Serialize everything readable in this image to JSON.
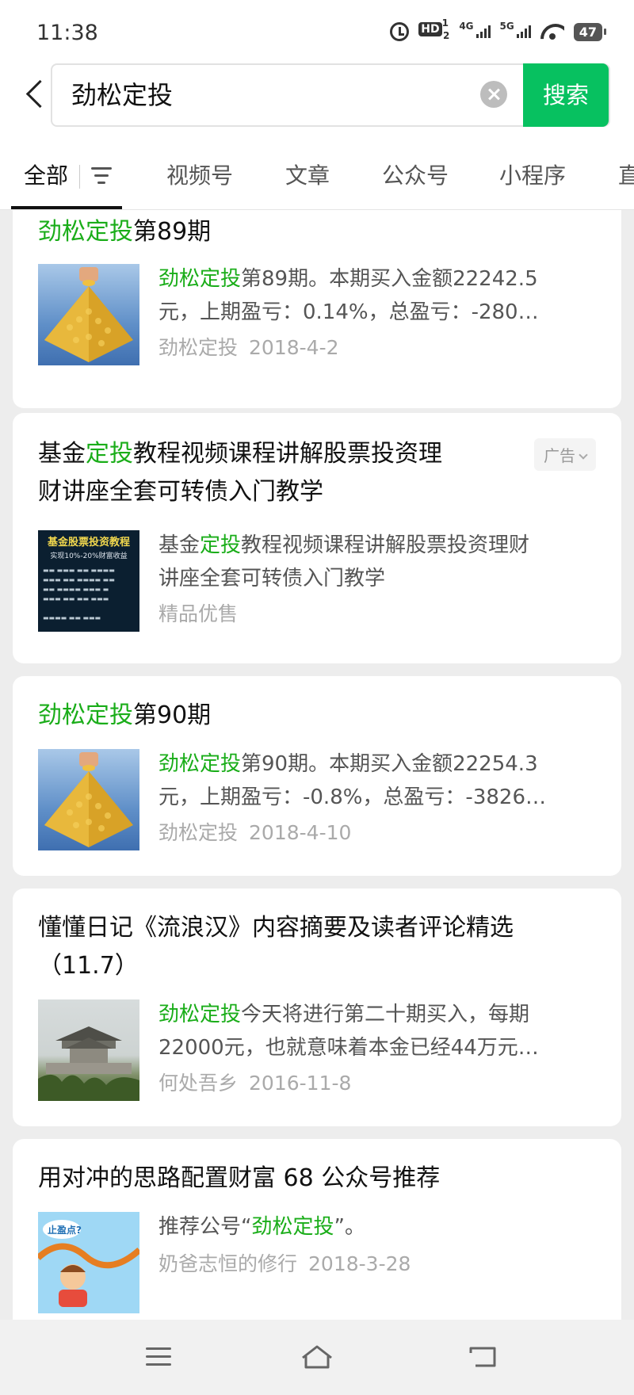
{
  "status_bar": {
    "time": "11:38",
    "hd_label": "HD",
    "hd_sup": "1",
    "hd_sub": "2",
    "net1": "4G",
    "net2": "5G",
    "battery": "47"
  },
  "search": {
    "query": "劲松定投",
    "button_label": "搜索"
  },
  "tabs": [
    {
      "label": "全部"
    },
    {
      "label": "视频号"
    },
    {
      "label": "文章"
    },
    {
      "label": "公众号"
    },
    {
      "label": "小程序"
    },
    {
      "label": "直"
    }
  ],
  "results": [
    {
      "title_hl": "劲松定投",
      "title_rest": "第89期",
      "snippet_hl": "劲松定投",
      "snippet_line1": "第89期。本期买入金额22242.5",
      "snippet_line2": "元，上期盈亏：0.14%，总盈亏：-280…",
      "source": "劲松定投",
      "date": "2018-4-2"
    },
    {
      "title_pre": "基金",
      "title_hl": "定投",
      "title_rest1": "教程视频课程讲解股票投资理",
      "title_rest2": "财讲座全套可转债入门教学",
      "snippet_pre": "基金",
      "snippet_hl": "定投",
      "snippet_line1": "教程视频课程讲解股票投资理财",
      "snippet_line2": "讲座全套可转债入门教学",
      "source": "精品优售",
      "ad_label": "广告",
      "thumb_title": "基金股票投资教程",
      "thumb_subtitle": "实现10%-20%财富收益"
    },
    {
      "title_hl": "劲松定投",
      "title_rest": "第90期",
      "snippet_hl": "劲松定投",
      "snippet_line1": "第90期。本期买入金额22254.3",
      "snippet_line2": "元，上期盈亏：-0.8%，总盈亏：-3826…",
      "source": "劲松定投",
      "date": "2018-4-10"
    },
    {
      "title_line1": "懂懂日记《流浪汉》内容摘要及读者评论精选",
      "title_line2": "（11.7）",
      "snippet_hl": "劲松定投",
      "snippet_line1": "今天将进行第二十期买入，每期",
      "snippet_line2": "22000元，也就意味着本金已经44万元…",
      "source": "何处吾乡",
      "date": "2016-11-8"
    },
    {
      "title": "用对冲的思路配置财富 68 公众号推荐",
      "snippet_pre": "推荐公号“",
      "snippet_hl": "劲松定投",
      "snippet_post": "”。",
      "source": "奶爸志恒的修行",
      "date": "2018-3-28",
      "thumb_label": "止盈点?"
    }
  ],
  "colors": {
    "accent_green": "#07c160",
    "highlight_green": "#1aad19"
  }
}
